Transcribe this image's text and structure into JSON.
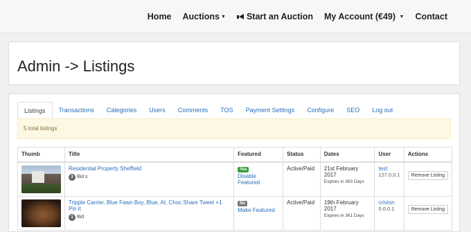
{
  "navbar": {
    "home": "Home",
    "auctions": "Auctions",
    "start_auction": "Start an Auction",
    "my_account": "My Account (€49)",
    "contact": "Contact"
  },
  "page": {
    "title": "Admin -> Listings"
  },
  "tabs": [
    "Listings",
    "Transactions",
    "Categories",
    "Users",
    "Comments",
    "TOS",
    "Payment Settings",
    "Configure",
    "SEO",
    "Log out"
  ],
  "alert": {
    "text": "5 total listings"
  },
  "table": {
    "headers": [
      "Thumb",
      "Title",
      "Featured",
      "Status",
      "Dates",
      "User",
      "Actions"
    ],
    "rows": [
      {
        "title": "Residential Property Sheffield",
        "bid_count": "3",
        "bid_label": "Bid s",
        "featured_badge": "Yes",
        "featured_action": "Disable Featured",
        "status": "Active/Paid",
        "date": "21st February 2017",
        "expires": "Expires in 363 Days",
        "user": "test",
        "ip": "127.0.0.1",
        "action": "Remove Listing"
      },
      {
        "title": "Tripple Carrier, Blue Fawn Boy, Blue, At, Choc Share Tweet +1 Pin it",
        "bid_count": "1",
        "bid_label": "Bid",
        "featured_badge": "No",
        "featured_action": "Make Featured",
        "status": "Active/Paid",
        "date": "19th February 2017",
        "expires": "Expires in 361 Days",
        "user": "crivion",
        "ip": "0.0.0.1",
        "action": "Remove Listing"
      }
    ]
  }
}
